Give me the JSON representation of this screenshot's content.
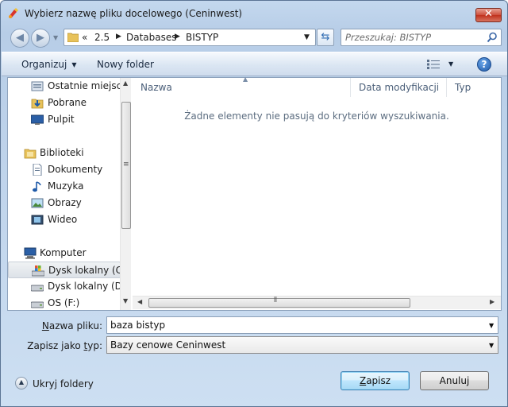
{
  "window": {
    "title": "Wybierz nazwę pliku docelowego (Ceninwest)",
    "close_glyph": "✕"
  },
  "navigation": {
    "back_glyph": "◀",
    "forward_glyph": "▶",
    "breadcrumb_overflow": "«",
    "breadcrumbs": [
      "2.5",
      "Databases",
      "BISTYP"
    ],
    "refresh_glyph": "⇆"
  },
  "search": {
    "placeholder": "Przeszukaj: BISTYP"
  },
  "toolbar": {
    "organize_label": "Organizuj",
    "new_folder_label": "Nowy folder",
    "help_glyph": "?"
  },
  "sidebar": {
    "items": [
      {
        "label": "Ostatnie miejsca",
        "icon": "recent-places-icon"
      },
      {
        "label": "Pobrane",
        "icon": "downloads-icon"
      },
      {
        "label": "Pulpit",
        "icon": "desktop-icon"
      },
      {
        "label": "Biblioteki",
        "icon": "libraries-icon"
      },
      {
        "label": "Dokumenty",
        "icon": "documents-icon"
      },
      {
        "label": "Muzyka",
        "icon": "music-icon"
      },
      {
        "label": "Obrazy",
        "icon": "pictures-icon"
      },
      {
        "label": "Wideo",
        "icon": "video-icon"
      },
      {
        "label": "Komputer",
        "icon": "computer-icon"
      },
      {
        "label": "Dysk lokalny (C:)",
        "icon": "drive-c-icon",
        "selected": true
      },
      {
        "label": "Dysk lokalny (D:)",
        "icon": "drive-d-icon"
      },
      {
        "label": "OS (F:)",
        "icon": "drive-f-icon"
      }
    ]
  },
  "file_list": {
    "columns": [
      "Nazwa",
      "Data modyfikacji",
      "Typ"
    ],
    "empty_message": "Żadne elementy nie pasują do kryteriów wyszukiwania."
  },
  "form": {
    "filename_label_pre": "",
    "filename_label_u": "N",
    "filename_label_post": "azwa pliku:",
    "filename_value": "baza bistyp",
    "filetype_label_pre": "Zapisz jako ",
    "filetype_label_u": "t",
    "filetype_label_post": "yp:",
    "filetype_value": "Bazy cenowe Ceninwest"
  },
  "footer": {
    "hide_folders_label": "Ukryj foldery",
    "save_label_u": "Z",
    "save_label_rest": "apisz",
    "cancel_label": "Anuluj"
  },
  "colors": {
    "accent": "#3c7fb1",
    "selection_bg": "#dde2e8"
  }
}
